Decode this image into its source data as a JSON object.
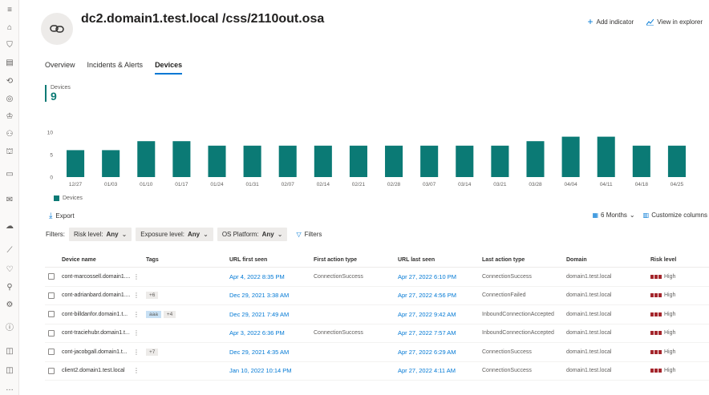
{
  "page": {
    "title": "dc2.domain1.test.local /css/2110out.osa",
    "add_indicator": "Add indicator",
    "view_in_explorer": "View in explorer"
  },
  "tabs": [
    {
      "label": "Overview",
      "active": false
    },
    {
      "label": "Incidents & Alerts",
      "active": false
    },
    {
      "label": "Devices",
      "active": true
    }
  ],
  "kpi": {
    "label": "Devices",
    "value": "9"
  },
  "chart_data": {
    "type": "bar",
    "categories": [
      "12/27",
      "01/03",
      "01/10",
      "01/17",
      "01/24",
      "01/31",
      "02/07",
      "02/14",
      "02/21",
      "02/28",
      "03/07",
      "03/14",
      "03/21",
      "03/28",
      "04/04",
      "04/11",
      "04/18",
      "04/25"
    ],
    "series": [
      {
        "name": "Devices",
        "values": [
          6,
          6,
          8,
          8,
          7,
          7,
          7,
          7,
          7,
          7,
          7,
          7,
          7,
          8,
          9,
          9,
          7,
          7
        ]
      }
    ],
    "yticks": [
      "0",
      "5",
      "10"
    ],
    "ylim": [
      0,
      10
    ],
    "color": "#0b7a75",
    "legend": "bottom-left"
  },
  "toolbar": {
    "export": "Export",
    "months": "6 Months",
    "customize": "Customize columns"
  },
  "filters": {
    "label": "Filters:",
    "risk_label": "Risk level:",
    "risk_value": "Any",
    "exposure_label": "Exposure level:",
    "exposure_value": "Any",
    "os_label": "OS Platform:",
    "os_value": "Any",
    "filters_link": "Filters"
  },
  "table": {
    "headers": {
      "name": "Device name",
      "tags": "Tags",
      "first_seen": "URL first seen",
      "first_action": "First action type",
      "last_seen": "URL last seen",
      "last_action": "Last action type",
      "domain": "Domain",
      "risk": "Risk level"
    },
    "rows": [
      {
        "name": "cont-marcossell.domain1....",
        "tags": [],
        "first_seen": "Apr 4, 2022 8:35 PM",
        "first_action": "ConnectionSuccess",
        "last_seen": "Apr 27, 2022 6:10 PM",
        "last_action": "ConnectionSuccess",
        "domain": "domain1.test.local",
        "risk": "High"
      },
      {
        "name": "cont-adrianbard.domain1....",
        "tags": [
          "+6"
        ],
        "first_seen": "Dec 29, 2021 3:38 AM",
        "first_action": "",
        "last_seen": "Apr 27, 2022 4:56 PM",
        "last_action": "ConnectionFailed",
        "domain": "domain1.test.local",
        "risk": "High"
      },
      {
        "name": "cont-billdanfor.domain1.t...",
        "tags": [
          "aaa",
          "+4"
        ],
        "first_seen": "Dec 29, 2021 7:49 AM",
        "first_action": "",
        "last_seen": "Apr 27, 2022 9:42 AM",
        "last_action": "InboundConnectionAccepted",
        "domain": "domain1.test.local",
        "risk": "High"
      },
      {
        "name": "cont-traciehubr.domain1.t...",
        "tags": [],
        "first_seen": "Apr 3, 2022 6:36 PM",
        "first_action": "ConnectionSuccess",
        "last_seen": "Apr 27, 2022 7:57 AM",
        "last_action": "InboundConnectionAccepted",
        "domain": "domain1.test.local",
        "risk": "High"
      },
      {
        "name": "cont-jacobgall.domain1.t...",
        "tags": [
          "+7"
        ],
        "first_seen": "Dec 29, 2021 4:35 AM",
        "first_action": "",
        "last_seen": "Apr 27, 2022 6:29 AM",
        "last_action": "ConnectionSuccess",
        "domain": "domain1.test.local",
        "risk": "High"
      },
      {
        "name": "client2.domain1.test.local",
        "tags": [],
        "first_seen": "Jan 10, 2022 10:14 PM",
        "first_action": "",
        "last_seen": "Apr 27, 2022 4:11 AM",
        "last_action": "ConnectionSuccess",
        "domain": "domain1.test.local",
        "risk": "High"
      }
    ]
  },
  "rail_icons": [
    "menu-icon",
    "home-icon",
    "shield-icon",
    "incidents-icon",
    "hunting-icon",
    "action-center-icon",
    "trophy-icon",
    "partners-icon",
    "evaluation-icon",
    "devices-icon",
    "mail-icon",
    "cloud-icon",
    "chart-icon",
    "health-icon",
    "permissions-icon",
    "settings-icon",
    "info-icon",
    "feedback-icon",
    "chat-icon",
    "more-icon"
  ]
}
